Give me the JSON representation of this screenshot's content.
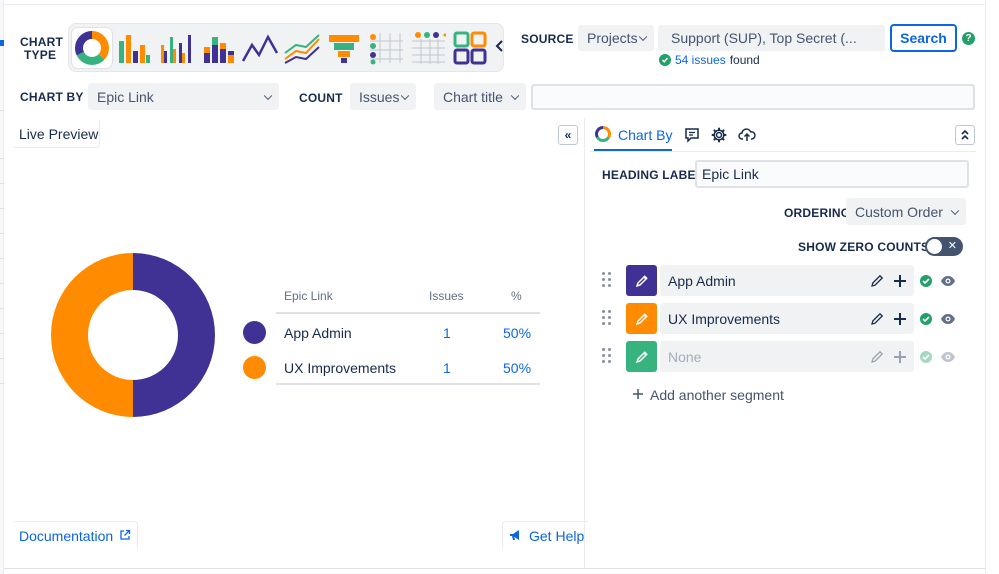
{
  "toolbar": {
    "chart_type_label_1": "CHART",
    "chart_type_label_2": "TYPE",
    "source_label": "SOURCE",
    "source_select": "Projects",
    "source_value": "Support (SUP), Top Secret (...",
    "search_label": "Search",
    "help_glyph": "?",
    "issues_found_count": "54 issues",
    "issues_found_suffix": "found",
    "chart_by_label": "CHART BY",
    "chart_by_value": "Epic Link",
    "count_label": "COUNT",
    "count_value": "Issues",
    "chart_title_select": "Chart title",
    "chart_title_value": "",
    "chart_types": [
      {
        "name": "donut",
        "active": true
      },
      {
        "name": "bar"
      },
      {
        "name": "grouped-bar"
      },
      {
        "name": "stacked-bar"
      },
      {
        "name": "line"
      },
      {
        "name": "multi-line"
      },
      {
        "name": "funnel"
      },
      {
        "name": "dot-matrix"
      },
      {
        "name": "heat-table"
      },
      {
        "name": "tiles"
      }
    ]
  },
  "preview": {
    "tab_label": "Live Preview",
    "collapse_glyph": "«",
    "documentation_label": "Documentation",
    "get_help_label": "Get Help"
  },
  "chart_data": {
    "type": "pie",
    "variant": "donut",
    "categories": [
      "App Admin",
      "UX Improvements"
    ],
    "values": [
      1,
      1
    ],
    "percentages": [
      "50%",
      "50%"
    ],
    "colors": [
      "#403294",
      "#ff8b00"
    ],
    "columns": [
      "Epic Link",
      "Issues",
      "%"
    ]
  },
  "panel": {
    "tab_label": "Chart By",
    "expand_glyph": "«",
    "heading_label": "HEADING LABEL",
    "heading_value": "Epic Link",
    "ordering_label": "ORDERING",
    "ordering_value": "Custom Order",
    "zero_counts_label": "SHOW ZERO COUNTS",
    "zero_counts_enabled": false,
    "toggle_glyph": "✕",
    "segments": [
      {
        "name": "App Admin",
        "color": "#403294",
        "enabled": true
      },
      {
        "name": "UX Improvements",
        "color": "#ff8b00",
        "enabled": true
      },
      {
        "name": "None",
        "color": "#36b37e",
        "enabled": false
      }
    ],
    "add_segment_label": "Add another segment"
  },
  "colors": {
    "accent": "#0c66e4",
    "success": "#22a06b"
  }
}
